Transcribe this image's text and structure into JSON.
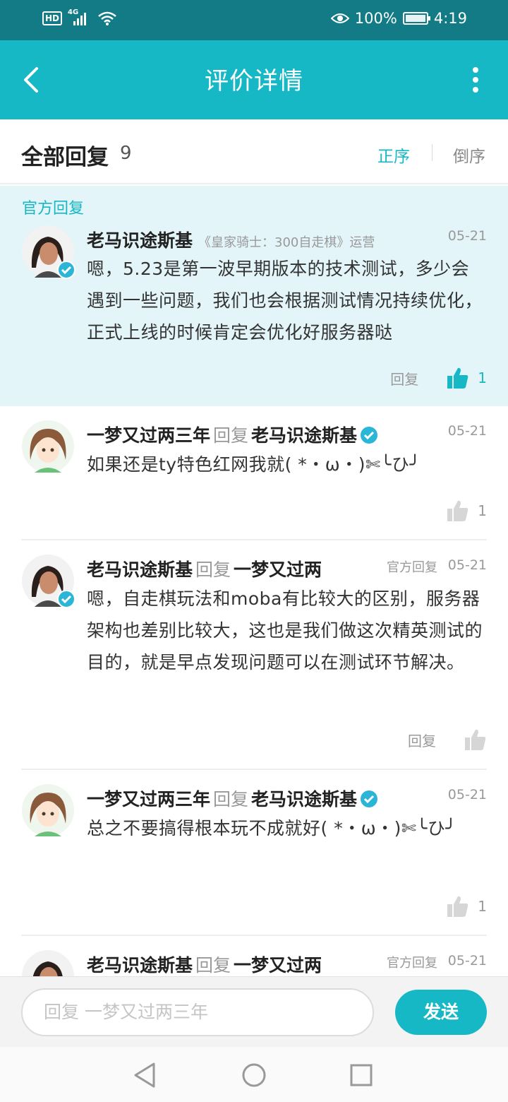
{
  "status_bar": {
    "hd": "HD",
    "network": "4G",
    "battery_percent": "100%",
    "time": "4:19"
  },
  "header": {
    "title": "评价详情"
  },
  "replies_header": {
    "title": "全部回复",
    "count": "9",
    "sort_asc": "正序",
    "sort_desc": "倒序"
  },
  "official_block": {
    "tag": "官方回复",
    "comment": {
      "username": "老马识途斯基",
      "game_tag": "《皇家骑士：300自走棋》运营",
      "date": "05-21",
      "text": "嗯，5.23是第一波早期版本的技术测试，多少会遇到一些问题，我们也会根据测试情况持续优化，正式上线的时候肯定会优化好服务器哒",
      "reply_label": "回复",
      "likes": "1"
    }
  },
  "comments": [
    {
      "username": "一梦又过两三年",
      "reply_word": "回复",
      "target": "老马识途斯基",
      "date": "05-21",
      "text": "如果还是ty特色红网我就( *・ω・)✄╰ひ╯",
      "likes": "1"
    },
    {
      "username": "老马识途斯基",
      "reply_word": "回复",
      "target": "一梦又过两",
      "official": "官方回复",
      "date": "05-21",
      "text": "嗯，自走棋玩法和moba有比较大的区别，服务器架构也差别比较大，这也是我们做这次精英测试的目的，就是早点发现问题可以在测试环节解决。",
      "reply_label": "回复"
    },
    {
      "username": "一梦又过两三年",
      "reply_word": "回复",
      "target": "老马识途斯基",
      "date": "05-21",
      "text": "总之不要搞得根本玩不成就好( *・ω・)✄╰ひ╯",
      "likes": "1"
    },
    {
      "username": "老马识途斯基",
      "reply_word": "回复",
      "target": "一梦又过两",
      "official": "官方回复",
      "date": "05-21"
    }
  ],
  "input_bar": {
    "placeholder": "回复 一梦又过两三年",
    "send_label": "发送"
  },
  "colors": {
    "primary": "#16b8c5",
    "status_bar": "#127b85",
    "official_bg": "#e3f5f8"
  },
  "icons": [
    "back-arrow-icon",
    "more-vertical-icon",
    "verified-icon",
    "thumbs-up-icon",
    "nav-back-icon",
    "nav-home-icon",
    "nav-recents-icon",
    "eye-icon",
    "wifi-icon",
    "battery-icon"
  ]
}
